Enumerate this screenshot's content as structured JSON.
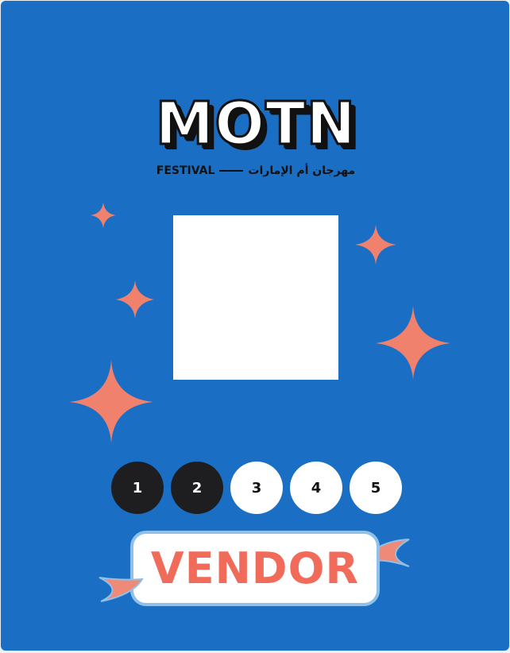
{
  "logo": {
    "title": "MOTN",
    "subtitle_latin": "FESTIVAL",
    "subtitle_arabic": "مهرجان أم الإمارات"
  },
  "photo": {
    "alt": ""
  },
  "steps": [
    {
      "label": "1",
      "state": "done"
    },
    {
      "label": "2",
      "state": "done"
    },
    {
      "label": "3",
      "state": "pending"
    },
    {
      "label": "4",
      "state": "pending"
    },
    {
      "label": "5",
      "state": "pending"
    }
  ],
  "badge": {
    "label": "VENDOR"
  },
  "colors": {
    "background": "#1a6fc4",
    "accent": "#f06b5a",
    "dark": "#1e1e20",
    "badge_border": "#8ec1ea"
  }
}
